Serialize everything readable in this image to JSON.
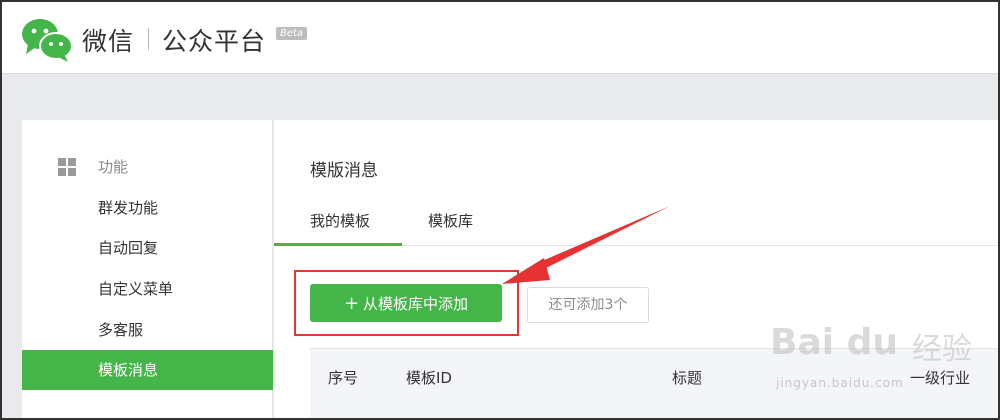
{
  "header": {
    "brand_name": "微信",
    "platform_name": "公众平台",
    "beta_badge": "Beta"
  },
  "sidebar": {
    "section_label": "功能",
    "section_icon": "grid-icon",
    "items": [
      {
        "label": "群发功能",
        "active": false
      },
      {
        "label": "自动回复",
        "active": false
      },
      {
        "label": "自定义菜单",
        "active": false
      },
      {
        "label": "多客服",
        "active": false
      },
      {
        "label": "模板消息",
        "active": true
      }
    ]
  },
  "main": {
    "title": "模版消息",
    "tabs": [
      {
        "label": "我的模板",
        "active": true
      },
      {
        "label": "模板库",
        "active": false
      }
    ],
    "add_button_label": "从模板库中添加",
    "add_button_icon": "plus-icon",
    "remaining_text": "还可添加3个",
    "table_headers": [
      "序号",
      "模板ID",
      "标题",
      "一级行业"
    ]
  },
  "watermark": {
    "baidu": "Bai du",
    "jingyan": "经验",
    "url": "jingyan.baidu.com"
  },
  "colors": {
    "accent_green": "#44b549",
    "annotation_red": "#e53232"
  }
}
